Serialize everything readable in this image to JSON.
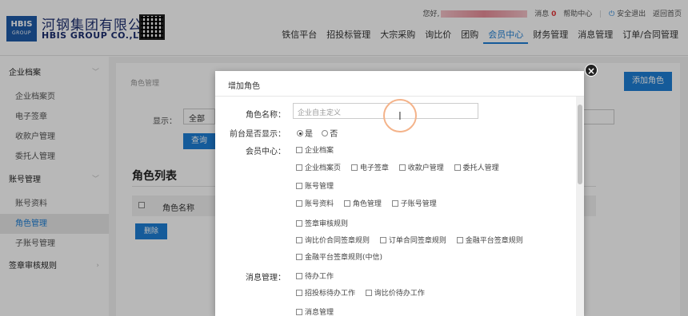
{
  "header": {
    "logo_abbr": "HBIS",
    "logo_sub": "GROUP",
    "company_cn": "河钢集团有限公司",
    "company_en": "HBIS GROUP CO.,LTD.",
    "greeting": "您好,",
    "messages_label": "消息",
    "messages_count": "0",
    "help_label": "帮助中心",
    "logout_label": "安全退出",
    "home_label": "返回首页",
    "nav": [
      "铁信平台",
      "招投标管理",
      "大宗采购",
      "询比价",
      "团购",
      "会员中心",
      "财务管理",
      "消息管理",
      "订单/合同管理"
    ],
    "nav_active_index": 5
  },
  "sidebar": {
    "groups": [
      {
        "label": "企业档案",
        "items": [
          "企业档案页",
          "电子签章",
          "收款户管理",
          "委托人管理"
        ]
      },
      {
        "label": "账号管理",
        "items": [
          "账号资料",
          "角色管理",
          "子账号管理"
        ]
      },
      {
        "label": "签章审核规则",
        "items": []
      }
    ],
    "active_item": "角色管理"
  },
  "content": {
    "breadcrumb": "角色管理",
    "add_button": "添加角色",
    "show_label": "显示：",
    "show_value": "全部",
    "query_button": "查询",
    "list_title": "角色列表",
    "col_role_name": "角色名称",
    "delete_button": "删除"
  },
  "modal": {
    "title": "增加角色",
    "role_name_label": "角色名称：",
    "role_name_placeholder": "企业自主定义",
    "frontend_label": "前台是否显示：",
    "radio_yes": "是",
    "radio_no": "否",
    "member_center_label": "会员中心：",
    "message_mgmt_label": "消息管理：",
    "perm_rows": [
      [
        "企业档案"
      ],
      [
        "企业档案页",
        "电子签章",
        "收款户管理",
        "委托人管理"
      ],
      [
        "账号管理"
      ],
      [
        "账号资料",
        "角色管理",
        "子账号管理"
      ],
      [
        "签章审核规则"
      ],
      [
        "询比价合同签章规则",
        "订单合同签章规则",
        "金融平台签章规则"
      ],
      [
        "金融平台签章规则(中信)"
      ],
      [
        "待办工作"
      ],
      [
        "招投标待办工作",
        "询比价待办工作"
      ],
      [
        "消息管理"
      ]
    ]
  }
}
